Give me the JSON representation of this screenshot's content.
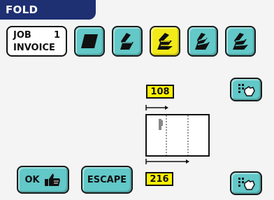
{
  "header": {
    "title": "FOLD SETTINGS"
  },
  "job": {
    "line1": "JOB",
    "number": "1",
    "line2": "INVOICE"
  },
  "fold_types": [
    {
      "icon": "no-fold-icon",
      "selected": false
    },
    {
      "icon": "single-fold-icon",
      "selected": false
    },
    {
      "icon": "letter-fold-icon",
      "selected": true
    },
    {
      "icon": "zigzag-fold-icon",
      "selected": false
    },
    {
      "icon": "double-parallel-fold-icon",
      "selected": false
    }
  ],
  "fold_values": {
    "fold_a": "108",
    "fold_b": "216"
  },
  "buttons": {
    "ok": "OK",
    "escape": "ESCAPE"
  },
  "colors": {
    "header": "#1e2f72",
    "button": "#63c8c8",
    "selected": "#f2ea18",
    "value_box": "#fff200"
  }
}
